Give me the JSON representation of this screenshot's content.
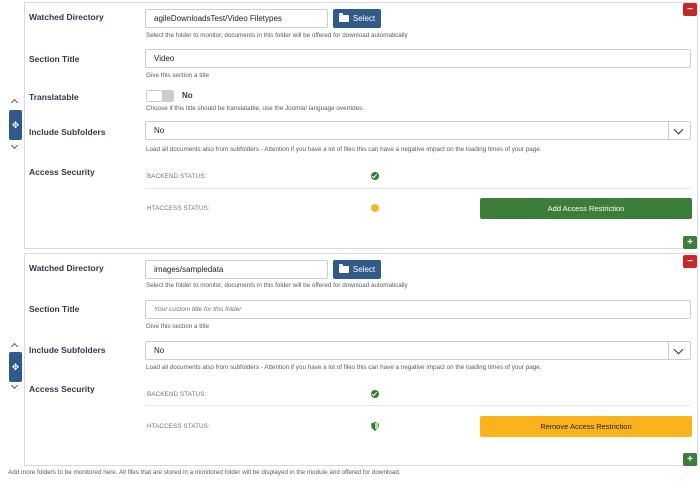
{
  "rows": [
    {
      "watched_directory_label": "Watched Directory",
      "directory_value": "agileDownloadsTest/Video Filetypes",
      "select_label": "Select",
      "directory_help": "Select the folder to monitor, documents in this folder will be offered for download automatically",
      "section_title_label": "Section Title",
      "section_title_value": "Video",
      "section_title_help": "Give this section a title",
      "translatable_label": "Translatable",
      "translatable_value": "No",
      "translatable_help": "Choose if this title should be translatable, use the Joomla! language overrides.",
      "include_subfolders_label": "Include Subfolders",
      "include_subfolders_value": "No",
      "include_subfolders_help": "Load all documents also from subfolders - Attention if you have a lot of files this can have a negative impact on the loading times of your page.",
      "access_security_label": "Access Security",
      "backend_status_label": "BACKEND STATUS:",
      "htaccess_status_label": "HTACCESS STATUS:",
      "action_label": "Add Access Restriction"
    },
    {
      "watched_directory_label": "Watched Directory",
      "directory_value": "images/sampledata",
      "select_label": "Select",
      "directory_help": "Select the folder to monitor, documents in this folder will be offered for download automatically",
      "section_title_label": "Section Title",
      "section_title_placeholder": "Your custom title for this folder",
      "section_title_help": "Give this section a title",
      "include_subfolders_label": "Include Subfolders",
      "include_subfolders_value": "No",
      "include_subfolders_help": "Load all documents also from subfolders - Attention if you have a lot of files this can have a negative impact on the loading times of your page.",
      "access_security_label": "Access Security",
      "backend_status_label": "BACKEND STATUS:",
      "htaccess_status_label": "HTACCESS STATUS:",
      "action_label": "Remove Access Restriction"
    }
  ],
  "footer_text": "Add more folders to be monitored here. All files that are stored in a monitored folder will be displayed in the module and offered for download.",
  "colors": {
    "primary": "#2f5a8a",
    "add_restriction": "#3d7d3a",
    "remove_restriction": "#fbb31b",
    "remove_row": "#c52827",
    "status_ok": "#2e7d32",
    "status_warning": "#f6b42a"
  }
}
